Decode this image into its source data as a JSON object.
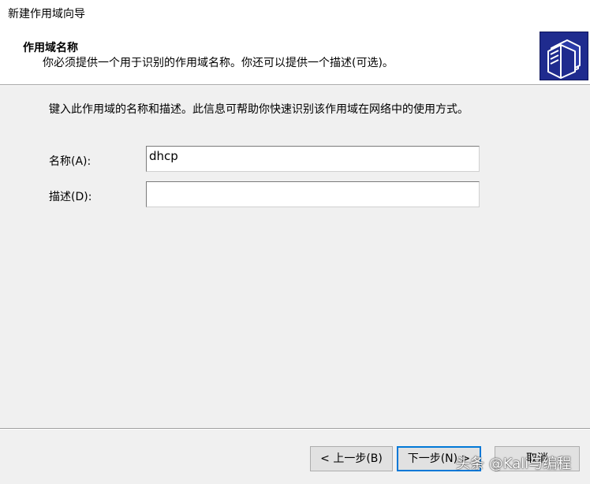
{
  "window": {
    "title": "新建作用域向导"
  },
  "header": {
    "title": "作用域名称",
    "subtitle": "你必须提供一个用于识别的作用域名称。你还可以提供一个描述(可选)。",
    "icon": "wizard-folders-icon"
  },
  "body": {
    "instructions": "键入此作用域的名称和描述。此信息可帮助你快速识别该作用域在网络中的使用方式。",
    "name_label": "名称(A):",
    "name_value": "dhcp",
    "description_label": "描述(D):",
    "description_value": ""
  },
  "buttons": {
    "back": "< 上一步(B)",
    "next": "下一步(N) >",
    "cancel": "取消"
  },
  "watermark": "头条 @Kali与编程",
  "colors": {
    "accent": "#0078d7",
    "icon_bg": "#1f2b8e"
  }
}
